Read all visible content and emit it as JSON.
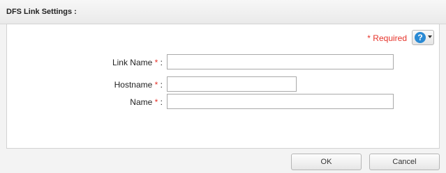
{
  "dialog": {
    "title": "DFS Link Settings :"
  },
  "form": {
    "required_note": "* Required",
    "help_icon": "question-icon",
    "fields": [
      {
        "label": "Link Name",
        "required_mark": "*",
        "colon": " :",
        "value": ""
      },
      {
        "label": "Hostname",
        "required_mark": "*",
        "colon": " :",
        "value": ""
      },
      {
        "label": "Name",
        "required_mark": "*",
        "colon": " :",
        "value": ""
      }
    ]
  },
  "buttons": {
    "ok_label": "OK",
    "cancel_label": "Cancel"
  },
  "colors": {
    "required": "#e6332a",
    "help": "#2a8ad4"
  }
}
